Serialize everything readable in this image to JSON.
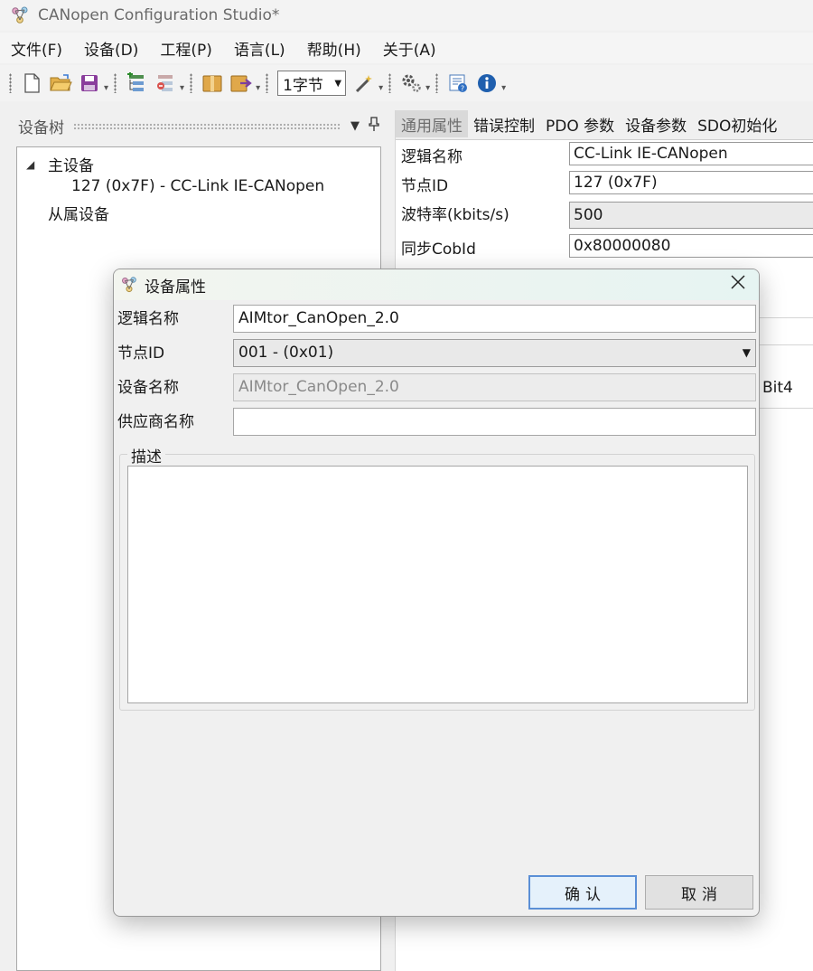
{
  "window": {
    "title": "CANopen Configuration Studio*"
  },
  "menu": [
    {
      "label": "文件(F)"
    },
    {
      "label": "设备(D)"
    },
    {
      "label": "工程(P)"
    },
    {
      "label": "语言(L)"
    },
    {
      "label": "帮助(H)"
    },
    {
      "label": "关于(A)"
    }
  ],
  "toolbar": {
    "icons": [
      "new-file-icon",
      "open-folder-icon",
      "save-icon",
      "add-device-icon",
      "remove-device-icon",
      "import-icon",
      "export-icon",
      "wizard-icon",
      "settings-gear-icon",
      "help-icon",
      "info-icon"
    ],
    "byte_combo_value": "1字节"
  },
  "device_tree": {
    "title": "设备树",
    "master_label": "主设备",
    "master_child": "127 (0x7F)  -  CC-Link IE-CANopen",
    "slave_label": "从属设备"
  },
  "properties": {
    "tabs": [
      "通用属性",
      "错误控制",
      "PDO 参数",
      "设备参数",
      "SDO初始化"
    ],
    "active_tab": 0,
    "rows": [
      {
        "name": "逻辑名称",
        "value": "CC-Link IE-CANopen"
      },
      {
        "name": "节点ID",
        "value": "127 (0x7F)"
      },
      {
        "name": "波特率(kbits/s)",
        "value": "500"
      },
      {
        "name": "同步CobId",
        "value": "0x80000080"
      }
    ],
    "bit_label": "Bit4"
  },
  "dialog": {
    "title": "设备属性",
    "logical_name_label": "逻辑名称",
    "logical_name_value": "AIMtor_CanOpen_2.0",
    "node_id_label": "节点ID",
    "node_id_value": "001 - (0x01)",
    "device_name_label": "设备名称",
    "device_name_value": "AIMtor_CanOpen_2.0",
    "vendor_label": "供应商名称",
    "vendor_value": "",
    "description_label": "描述",
    "description_value": "",
    "ok_label": "确认",
    "cancel_label": "取消"
  },
  "colors": {
    "accent_blue": "#5b8fd6",
    "tab_active_bg": "#d9d9d9",
    "dialog_title_bg": "#e6f4f2"
  }
}
